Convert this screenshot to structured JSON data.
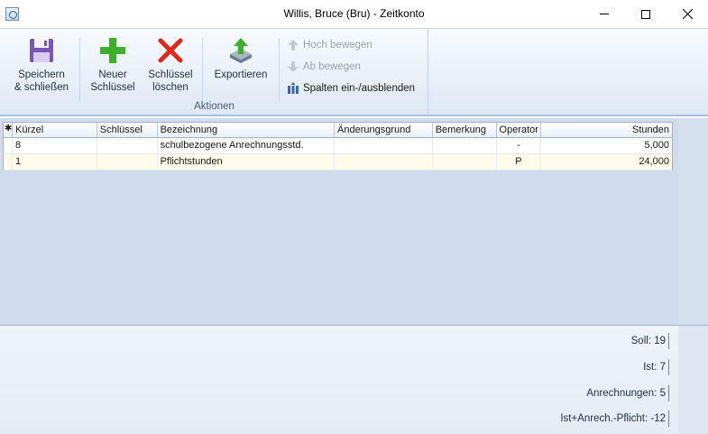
{
  "window": {
    "title": "Willis, Bruce (Bru) - Zeitkonto"
  },
  "ribbon": {
    "save": {
      "line1": "Speichern",
      "line2": "& schließen"
    },
    "new_key": {
      "line1": "Neuer",
      "line2": "Schlüssel"
    },
    "delete_key": {
      "line1": "Schlüssel",
      "line2": "löschen"
    },
    "export": {
      "label": "Exportieren"
    },
    "move_up": {
      "label": "Hoch bewegen",
      "enabled": false
    },
    "move_down": {
      "label": "Ab bewegen",
      "enabled": false
    },
    "toggle_columns": {
      "label": "Spalten ein-/ausblenden"
    },
    "group_label": "Aktionen"
  },
  "grid": {
    "columns": [
      "Kürzel",
      "Schlüssel",
      "Bezeichnung",
      "Änderungsgrund",
      "Bemerkung",
      "Operator",
      "Stunden"
    ],
    "rows": [
      {
        "kuerzel": "8",
        "schluessel": "",
        "bezeichnung": "schulbezogene Anrechnungsstd.",
        "aenderungsgrund": "",
        "bemerkung": "",
        "operator": "-",
        "stunden": "5,000"
      },
      {
        "kuerzel": "1",
        "schluessel": "",
        "bezeichnung": "Pflichtstunden",
        "aenderungsgrund": "",
        "bemerkung": "",
        "operator": "P",
        "stunden": "24,000"
      }
    ]
  },
  "summary": {
    "soll": "Soll: 19",
    "ist": "Ist: 7",
    "anrechnungen": "Anrechnungen: 5",
    "total": "Ist+Anrech.-Pflicht: -12"
  },
  "colors": {
    "accent": "#2d5f9a",
    "row_alt": "#fffbea",
    "grid_bg": "#cfdced"
  }
}
